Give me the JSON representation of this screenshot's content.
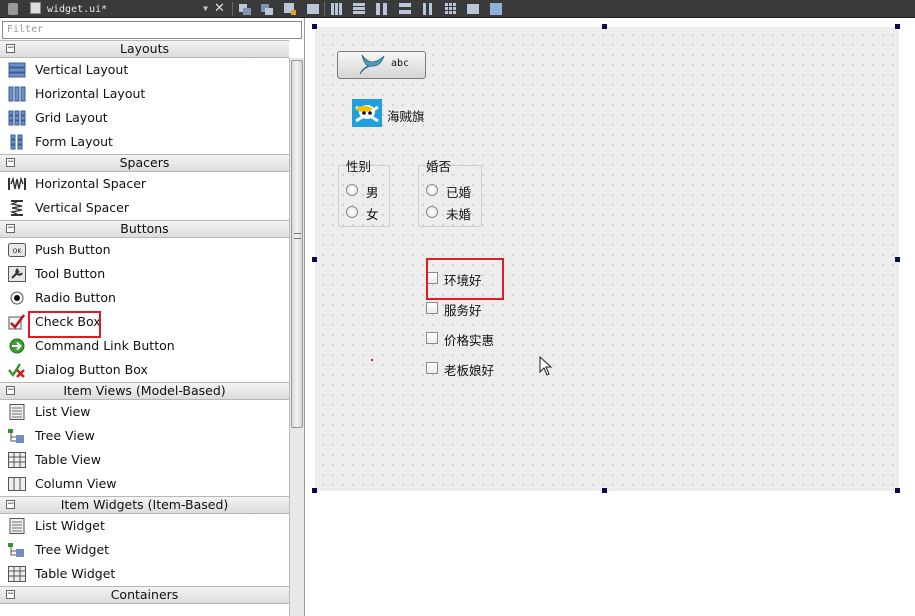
{
  "toolbar": {
    "document_name": "widget.ui*"
  },
  "widget_box": {
    "filter_placeholder": "Filter",
    "categories": [
      {
        "label": "Layouts",
        "items": [
          "Vertical Layout",
          "Horizontal Layout",
          "Grid Layout",
          "Form Layout"
        ]
      },
      {
        "label": "Spacers",
        "items": [
          "Horizontal Spacer",
          "Vertical Spacer"
        ]
      },
      {
        "label": "Buttons",
        "items": [
          "Push Button",
          "Tool Button",
          "Radio Button",
          "Check Box",
          "Command Link Button",
          "Dialog Button Box"
        ]
      },
      {
        "label": "Item Views (Model-Based)",
        "items": [
          "List View",
          "Tree View",
          "Table View",
          "Column View"
        ]
      },
      {
        "label": "Item Widgets (Item-Based)",
        "items": [
          "List Widget",
          "Tree Widget",
          "Table Widget"
        ]
      },
      {
        "label": "Containers",
        "items": []
      }
    ],
    "highlighted_item": "Check Box"
  },
  "form": {
    "push_button_label": "abc",
    "pirate_label": "海贼旗",
    "gender_group": {
      "title": "性别",
      "options": [
        "男",
        "女"
      ]
    },
    "marital_group": {
      "title": "婚否",
      "options": [
        "已婚",
        "未婚"
      ]
    },
    "checkboxes": [
      "环境好",
      "服务好",
      "价格实惠",
      "老板娘好"
    ],
    "highlighted_checkbox": "环境好"
  },
  "colors": {
    "highlight_red": "#e01b24",
    "toolbar_dark": "#3a3a3a",
    "pirate_icon_blue": "#1fa0dc"
  }
}
